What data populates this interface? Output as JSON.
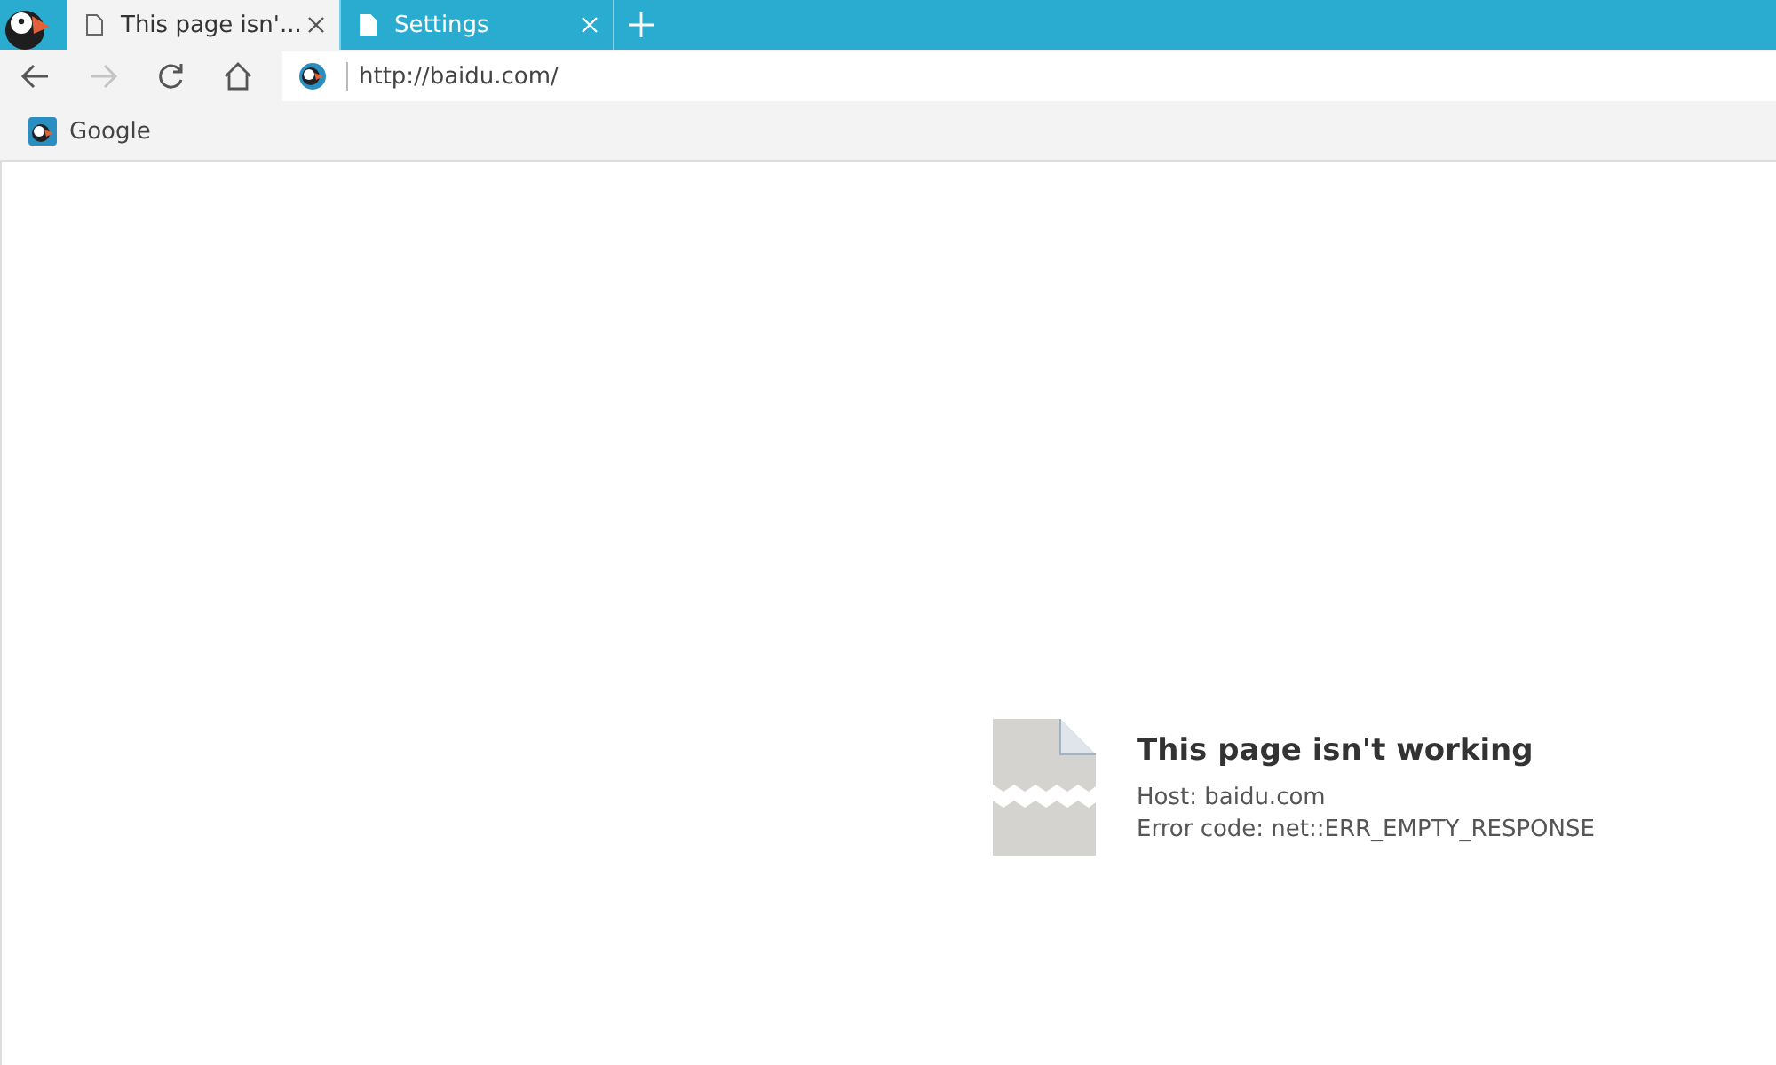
{
  "tabs": [
    {
      "title": "This page isn'...",
      "selected": true
    },
    {
      "title": "Settings",
      "selected": false
    }
  ],
  "toolbar": {
    "buttons": [
      {
        "kind": "back",
        "disabled": false
      },
      {
        "kind": "forward",
        "disabled": true
      },
      {
        "kind": "reload",
        "disabled": false
      },
      {
        "kind": "home",
        "disabled": false
      }
    ],
    "url": "http://baidu.com/"
  },
  "bookmarks": [
    {
      "label": "Google"
    }
  ],
  "error": {
    "title": "This page isn't working",
    "host": "Host: baidu.com",
    "code": "Error code: net::ERR_EMPTY_RESPONSE"
  }
}
